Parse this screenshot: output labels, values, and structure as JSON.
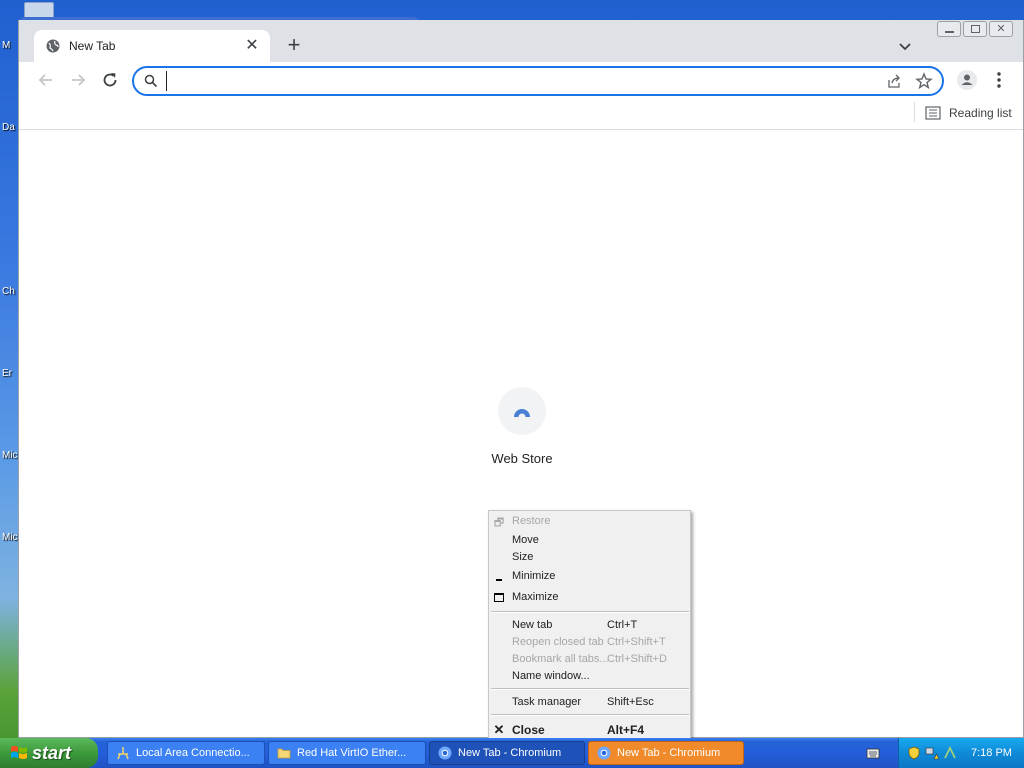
{
  "desktop": {
    "labels": [
      "M",
      "Da",
      "Ch (M",
      "Er",
      "Mic",
      "Micr"
    ]
  },
  "browser": {
    "tab_title": "New Tab",
    "omnibox_value": "",
    "bookmarks": {
      "reading_list_label": "Reading list"
    },
    "shortcut_label": "Web Store"
  },
  "context_menu": {
    "items": [
      {
        "label": "Restore",
        "shortcut": "",
        "disabled": true,
        "glyph": "restore-icon"
      },
      {
        "label": "Move",
        "shortcut": "",
        "disabled": false
      },
      {
        "label": "Size",
        "shortcut": "",
        "disabled": false
      },
      {
        "label": "Minimize",
        "shortcut": "",
        "disabled": false,
        "glyph": "minimize-icon"
      },
      {
        "label": "Maximize",
        "shortcut": "",
        "disabled": false,
        "glyph": "maximize-icon"
      },
      {
        "label": "New tab",
        "shortcut": "Ctrl+T",
        "disabled": false
      },
      {
        "label": "Reopen closed tab",
        "shortcut": "Ctrl+Shift+T",
        "disabled": true
      },
      {
        "label": "Bookmark all tabs...",
        "shortcut": "Ctrl+Shift+D",
        "disabled": true
      },
      {
        "label": "Name window...",
        "shortcut": "",
        "disabled": false
      },
      {
        "label": "Task manager",
        "shortcut": "Shift+Esc",
        "disabled": false
      },
      {
        "label": "Close",
        "shortcut": "Alt+F4",
        "disabled": false,
        "bold": true,
        "glyph": "close-icon"
      }
    ]
  },
  "taskbar": {
    "start_label": "start",
    "buttons": [
      {
        "label": "Local Area Connectio...",
        "icon": "network-icon"
      },
      {
        "label": "Red Hat VirtIO Ether...",
        "icon": "folder-icon"
      },
      {
        "label": "New Tab - Chromium",
        "icon": "chromium-icon"
      },
      {
        "label": "New Tab - Chromium",
        "icon": "chromium-icon"
      }
    ],
    "clock": "7:18 PM"
  },
  "colors": {
    "accent": "#1a73e8",
    "taskbar": "#245edb",
    "start_green": "#3c9a3c",
    "flash_orange": "#f08a2a"
  }
}
